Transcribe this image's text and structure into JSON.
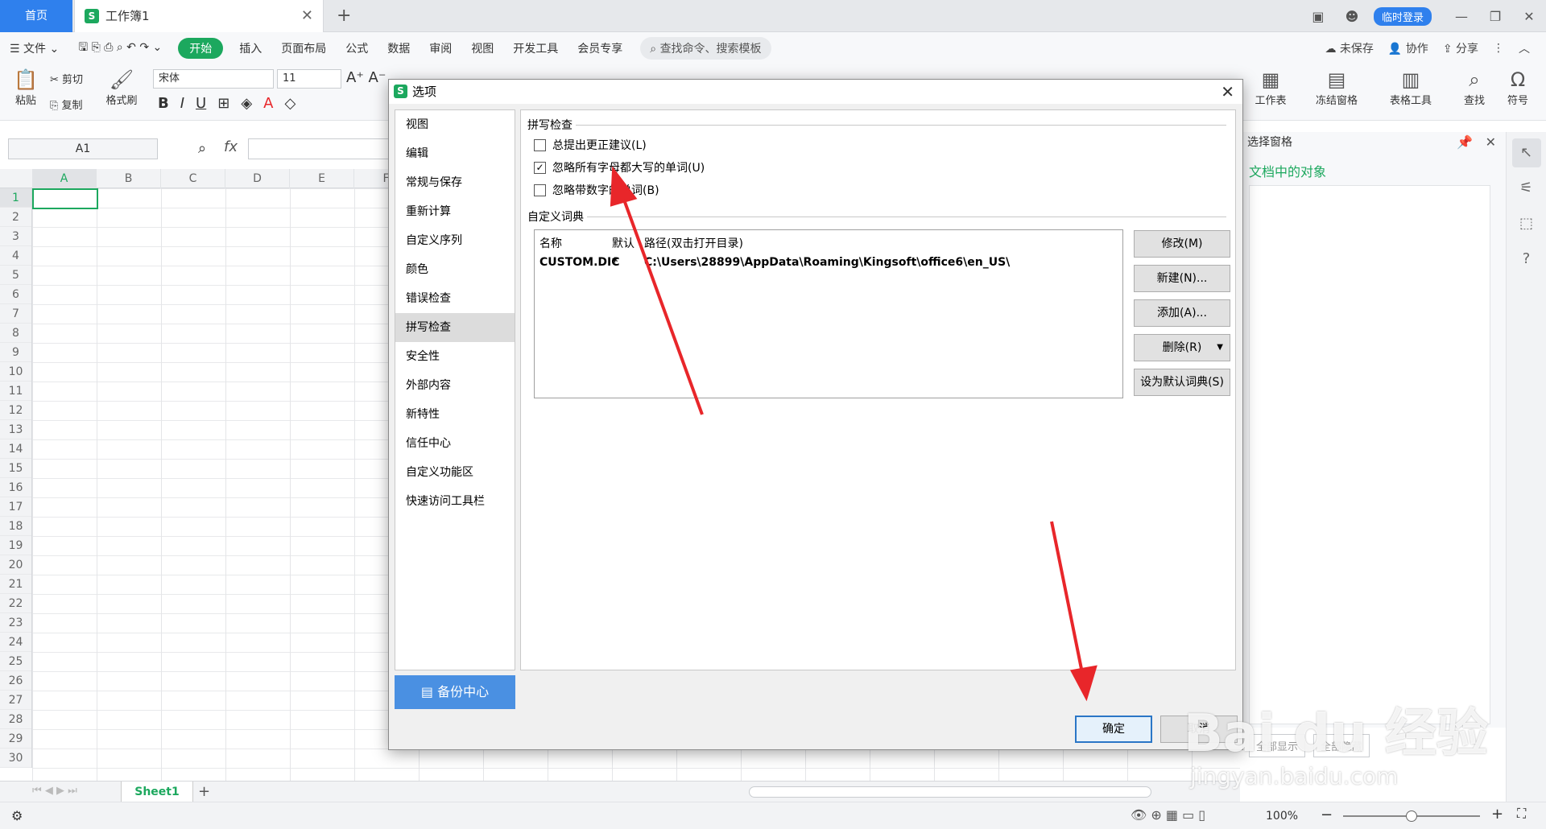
{
  "tabbar": {
    "home": "首页",
    "doc_icon": "S",
    "doc_title": "工作簿1",
    "login": "临时登录"
  },
  "menubar": {
    "file": "文件",
    "items": [
      "开始",
      "插入",
      "页面布局",
      "公式",
      "数据",
      "审阅",
      "视图",
      "开发工具",
      "会员专享"
    ],
    "search": "查找命令、搜索模板",
    "unsaved": "未保存",
    "collab": "协作",
    "share": "分享"
  },
  "ribbon": {
    "paste": "粘贴",
    "cut": "剪切",
    "copy": "复制",
    "format_painter": "格式刷",
    "font": "宋体",
    "size": "11",
    "worksheet": "工作表",
    "freeze": "冻结窗格",
    "table_tools": "表格工具",
    "find": "查找",
    "symbol": "符号"
  },
  "formula_bar": {
    "cell_ref": "A1",
    "fx": "fx"
  },
  "grid": {
    "columns": [
      "A",
      "B",
      "C",
      "D",
      "E",
      "F"
    ],
    "rows": [
      "1",
      "2",
      "3",
      "4",
      "5",
      "6",
      "7",
      "8",
      "9",
      "10",
      "11",
      "12",
      "13",
      "14",
      "15",
      "16",
      "17",
      "18",
      "19",
      "20",
      "21",
      "22",
      "23",
      "24",
      "25",
      "26",
      "27",
      "28",
      "29",
      "30"
    ]
  },
  "sheets": {
    "tab": "Sheet1"
  },
  "status": {
    "zoom": "100%"
  },
  "side_pane": {
    "title": "选择窗格",
    "subtitle": "文档中的对象",
    "show_all": "全部显示",
    "hide_all": "全部隐藏"
  },
  "dialog": {
    "icon": "S",
    "title": "选项",
    "nav": [
      "视图",
      "编辑",
      "常规与保存",
      "重新计算",
      "自定义序列",
      "颜色",
      "错误检查",
      "拼写检查",
      "安全性",
      "外部内容",
      "新特性",
      "信任中心",
      "自定义功能区",
      "快速访问工具栏"
    ],
    "selected_nav": "拼写检查",
    "backup": "备份中心",
    "spell_group": "拼写检查",
    "options": [
      {
        "label": "总提出更正建议(L)",
        "checked": false
      },
      {
        "label": "忽略所有字母都大写的单词(U)",
        "checked": true
      },
      {
        "label": "忽略带数字的单词(B)",
        "checked": false
      }
    ],
    "dict_group": "自定义词典",
    "dict_headers": [
      "名称",
      "默认",
      "路径(双击打开目录)"
    ],
    "dict_row": {
      "name": "CUSTOM.DIC",
      "default": "*",
      "path": "C:\\Users\\28899\\AppData\\Roaming\\Kingsoft\\office6\\en_US\\"
    },
    "buttons": [
      "修改(M)",
      "新建(N)...",
      "添加(A)...",
      "删除(R)",
      "设为默认词典(S)"
    ],
    "ok": "确定",
    "cancel": "取消"
  },
  "watermark": {
    "brand": "Bai du 经验",
    "url": "jingyan.baidu.com"
  },
  "colors": {
    "accent": "#1ca85e",
    "tab_blue": "#2f80ed",
    "arrow": "#e8262a",
    "backup_blue": "#4a90e2"
  }
}
